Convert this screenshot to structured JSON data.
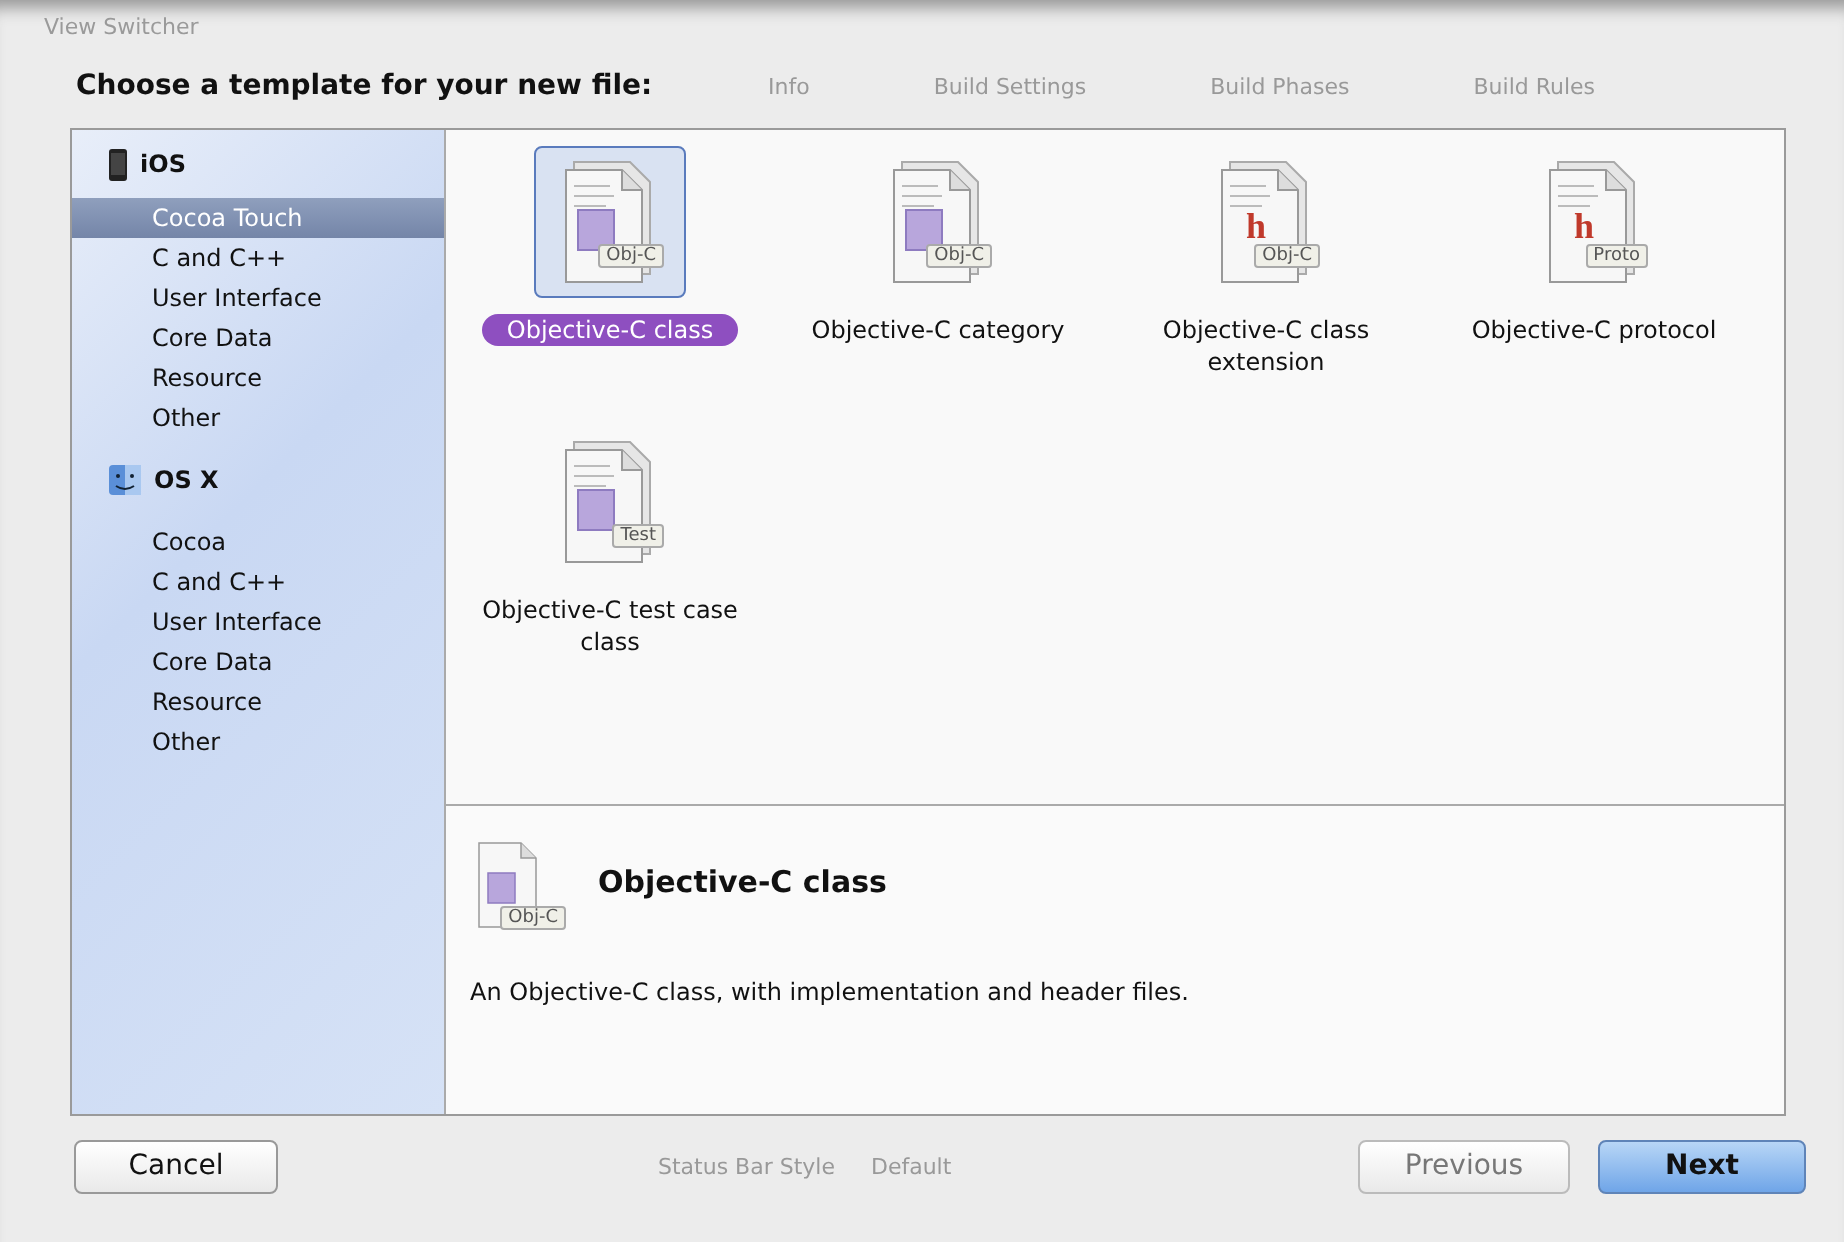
{
  "backdrop": {
    "title": "View Switcher",
    "tabs": [
      "Info",
      "Build Settings",
      "Build Phases",
      "Build Rules"
    ],
    "field_label": "Status Bar Style",
    "field_value": "Default"
  },
  "heading": "Choose a template for your new file:",
  "sidebar": [
    {
      "platform": "iOS",
      "kind": "phone",
      "items": [
        {
          "label": "Cocoa Touch",
          "selected": true
        },
        {
          "label": "C and C++",
          "selected": false
        },
        {
          "label": "User Interface",
          "selected": false
        },
        {
          "label": "Core Data",
          "selected": false
        },
        {
          "label": "Resource",
          "selected": false
        },
        {
          "label": "Other",
          "selected": false
        }
      ]
    },
    {
      "platform": "OS X",
      "kind": "finder",
      "items": [
        {
          "label": "Cocoa",
          "selected": false
        },
        {
          "label": "C and C++",
          "selected": false
        },
        {
          "label": "User Interface",
          "selected": false
        },
        {
          "label": "Core Data",
          "selected": false
        },
        {
          "label": "Resource",
          "selected": false
        },
        {
          "label": "Other",
          "selected": false
        }
      ]
    }
  ],
  "templates": [
    {
      "name": "Objective-C class",
      "badge": "Obj-C",
      "kind": "class",
      "selected": true
    },
    {
      "name": "Objective-C category",
      "badge": "Obj-C",
      "kind": "class",
      "selected": false
    },
    {
      "name": "Objective-C class extension",
      "badge": "Obj-C",
      "kind": "header",
      "glyph": "h",
      "selected": false
    },
    {
      "name": "Objective-C protocol",
      "badge": "Proto",
      "kind": "header",
      "glyph": "h",
      "selected": false
    },
    {
      "name": "Objective-C test case class",
      "badge": "Test",
      "kind": "class",
      "selected": false
    }
  ],
  "details": {
    "title": "Objective-C class",
    "badge": "Obj-C",
    "description": "An Objective-C class, with implementation and header files."
  },
  "buttons": {
    "cancel": "Cancel",
    "previous": "Previous",
    "next": "Next"
  }
}
